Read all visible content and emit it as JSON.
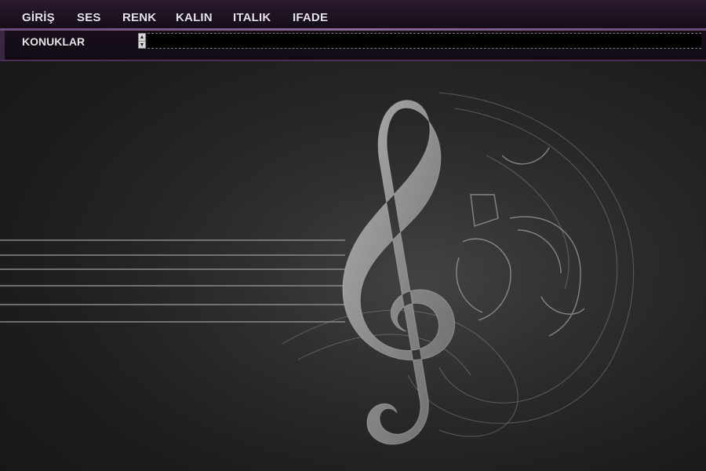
{
  "menu": {
    "items": [
      {
        "label": "GİRİŞ"
      },
      {
        "label": "SES"
      },
      {
        "label": "RENK"
      },
      {
        "label": "KALIN"
      },
      {
        "label": "ITALIK"
      },
      {
        "label": "IFADE"
      }
    ]
  },
  "toolbar": {
    "guests_label": "KONUKLAR"
  },
  "colors": {
    "chrome_bg": "#160d19",
    "accent": "#8c6a98",
    "menu_text": "#e8e2ea",
    "background": "#1f1f1f"
  },
  "icons": {
    "stepper": "up-down-arrows-icon",
    "artwork": "treble-clef-icon"
  }
}
